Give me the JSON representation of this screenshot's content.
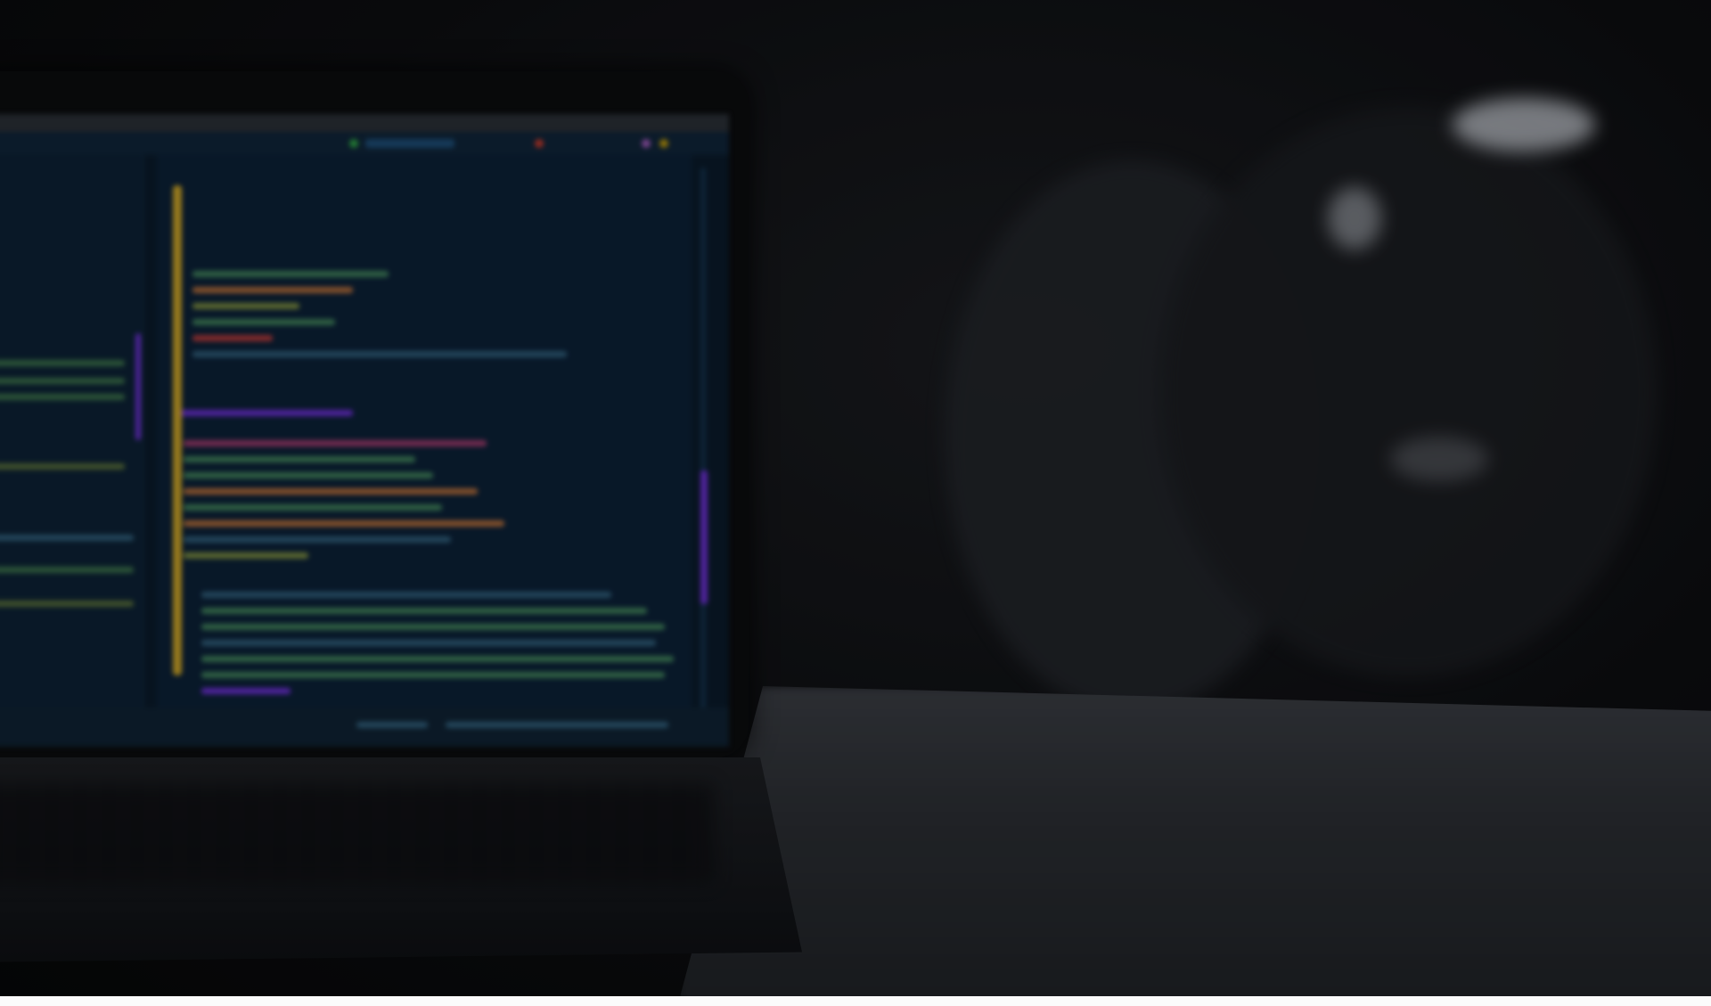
{
  "scene": {
    "description_kind": "photo",
    "subject": "laptop-with-code-editor",
    "brand_label": "",
    "colors": {
      "background": "#0d0e11",
      "screen": "#0a1a2a",
      "gutter_accent": "#c9a227",
      "scroll_accent": "#6a2fd0",
      "table": "#2b2e33"
    }
  }
}
